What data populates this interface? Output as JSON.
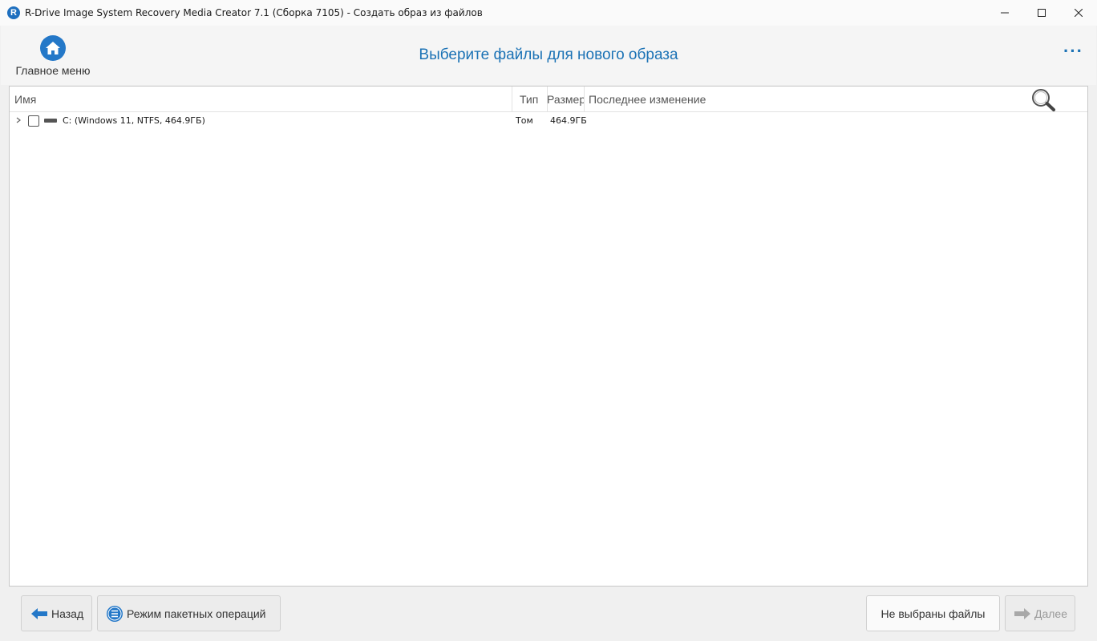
{
  "window": {
    "app_icon_letter": "R",
    "title": "R-Drive Image System Recovery Media Creator 7.1 (Сборка 7105) - Создать образ из файлов",
    "controls": [
      "minimize-icon",
      "maximize-icon",
      "close-icon"
    ]
  },
  "header": {
    "home_label": "Главное меню",
    "page_title": "Выберите файлы для нового образа",
    "more_label": "···"
  },
  "columns": {
    "name": "Имя",
    "type": "Тип",
    "size": "Размер",
    "modified": "Последнее изменение"
  },
  "rows": [
    {
      "name": "C: (Windows 11, NTFS, 464.9ГБ)",
      "type": "Том",
      "size": "464.9ГБ",
      "modified": "",
      "checked": false,
      "expanded": false
    }
  ],
  "footer": {
    "back_label": "Назад",
    "batch_label": "Режим пакетных операций",
    "status_label": "Не выбраны файлы",
    "next_label": "Далее"
  },
  "colors": {
    "accent": "#1b72b5",
    "icon_blue": "#2478c8",
    "disabled_text": "#999999"
  }
}
